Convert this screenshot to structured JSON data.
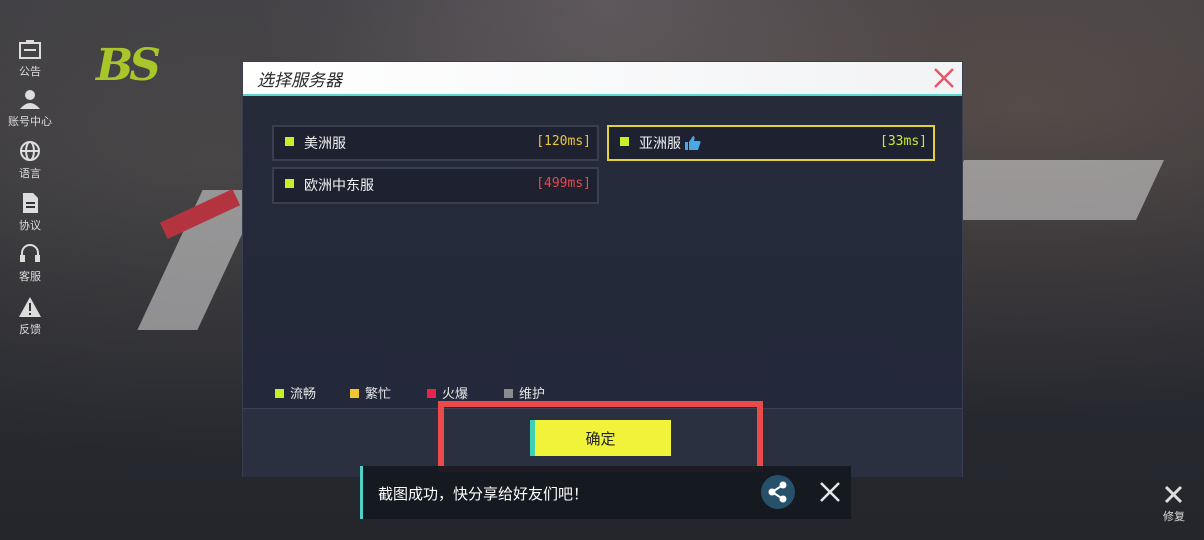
{
  "sidebar": {
    "items": [
      {
        "label": "公告",
        "icon": "announcement-icon"
      },
      {
        "label": "账号中心",
        "icon": "account-icon"
      },
      {
        "label": "语言",
        "icon": "globe-icon"
      },
      {
        "label": "协议",
        "icon": "document-icon"
      },
      {
        "label": "客服",
        "icon": "headset-icon"
      },
      {
        "label": "反馈",
        "icon": "warning-icon"
      }
    ],
    "repair_label": "修复"
  },
  "dialog": {
    "title": "选择服务器",
    "servers": [
      {
        "name": "美洲服",
        "ping": "[120ms]",
        "ping_color": "#e8c63a",
        "status_color": "#c6ef2a",
        "selected": false
      },
      {
        "name": "亚洲服",
        "ping": "[33ms]",
        "ping_color": "#c6ef2a",
        "status_color": "#c6ef2a",
        "selected": true,
        "recommended": true
      },
      {
        "name": "欧洲中东服",
        "ping": "[499ms]",
        "ping_color": "#e84848",
        "status_color": "#c6ef2a",
        "selected": false
      }
    ],
    "legend": [
      {
        "label": "流畅",
        "color": "#c6ef2a"
      },
      {
        "label": "繁忙",
        "color": "#f2c531"
      },
      {
        "label": "火爆",
        "color": "#e6254a"
      },
      {
        "label": "维护",
        "color": "#8c8c8c"
      }
    ],
    "confirm_label": "确定"
  },
  "toast": {
    "text": "截图成功，快分享给好友们吧！"
  },
  "colors": {
    "accent": "#f1f23a",
    "highlight": "#ea4a4a",
    "teal": "#4fd2c7"
  }
}
